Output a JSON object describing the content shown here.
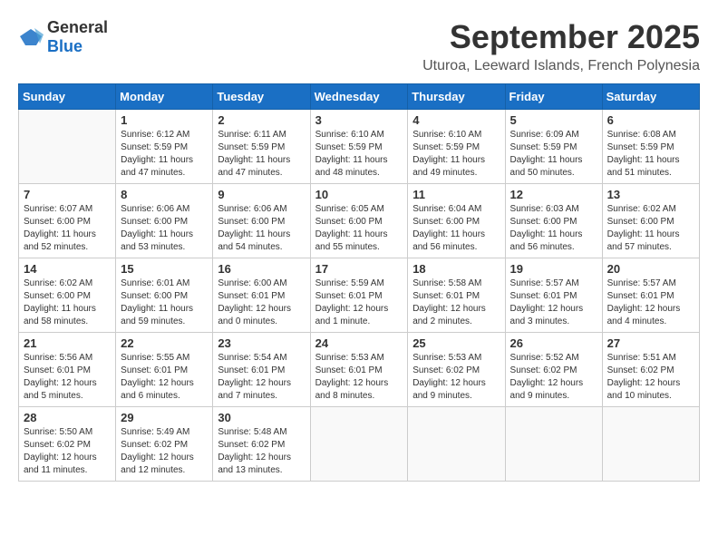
{
  "logo": {
    "general": "General",
    "blue": "Blue"
  },
  "title": "September 2025",
  "location": "Uturoa, Leeward Islands, French Polynesia",
  "weekdays": [
    "Sunday",
    "Monday",
    "Tuesday",
    "Wednesday",
    "Thursday",
    "Friday",
    "Saturday"
  ],
  "weeks": [
    [
      {
        "day": "",
        "info": ""
      },
      {
        "day": "1",
        "info": "Sunrise: 6:12 AM\nSunset: 5:59 PM\nDaylight: 11 hours\nand 47 minutes."
      },
      {
        "day": "2",
        "info": "Sunrise: 6:11 AM\nSunset: 5:59 PM\nDaylight: 11 hours\nand 47 minutes."
      },
      {
        "day": "3",
        "info": "Sunrise: 6:10 AM\nSunset: 5:59 PM\nDaylight: 11 hours\nand 48 minutes."
      },
      {
        "day": "4",
        "info": "Sunrise: 6:10 AM\nSunset: 5:59 PM\nDaylight: 11 hours\nand 49 minutes."
      },
      {
        "day": "5",
        "info": "Sunrise: 6:09 AM\nSunset: 5:59 PM\nDaylight: 11 hours\nand 50 minutes."
      },
      {
        "day": "6",
        "info": "Sunrise: 6:08 AM\nSunset: 5:59 PM\nDaylight: 11 hours\nand 51 minutes."
      }
    ],
    [
      {
        "day": "7",
        "info": "Sunrise: 6:07 AM\nSunset: 6:00 PM\nDaylight: 11 hours\nand 52 minutes."
      },
      {
        "day": "8",
        "info": "Sunrise: 6:06 AM\nSunset: 6:00 PM\nDaylight: 11 hours\nand 53 minutes."
      },
      {
        "day": "9",
        "info": "Sunrise: 6:06 AM\nSunset: 6:00 PM\nDaylight: 11 hours\nand 54 minutes."
      },
      {
        "day": "10",
        "info": "Sunrise: 6:05 AM\nSunset: 6:00 PM\nDaylight: 11 hours\nand 55 minutes."
      },
      {
        "day": "11",
        "info": "Sunrise: 6:04 AM\nSunset: 6:00 PM\nDaylight: 11 hours\nand 56 minutes."
      },
      {
        "day": "12",
        "info": "Sunrise: 6:03 AM\nSunset: 6:00 PM\nDaylight: 11 hours\nand 56 minutes."
      },
      {
        "day": "13",
        "info": "Sunrise: 6:02 AM\nSunset: 6:00 PM\nDaylight: 11 hours\nand 57 minutes."
      }
    ],
    [
      {
        "day": "14",
        "info": "Sunrise: 6:02 AM\nSunset: 6:00 PM\nDaylight: 11 hours\nand 58 minutes."
      },
      {
        "day": "15",
        "info": "Sunrise: 6:01 AM\nSunset: 6:00 PM\nDaylight: 11 hours\nand 59 minutes."
      },
      {
        "day": "16",
        "info": "Sunrise: 6:00 AM\nSunset: 6:01 PM\nDaylight: 12 hours\nand 0 minutes."
      },
      {
        "day": "17",
        "info": "Sunrise: 5:59 AM\nSunset: 6:01 PM\nDaylight: 12 hours\nand 1 minute."
      },
      {
        "day": "18",
        "info": "Sunrise: 5:58 AM\nSunset: 6:01 PM\nDaylight: 12 hours\nand 2 minutes."
      },
      {
        "day": "19",
        "info": "Sunrise: 5:57 AM\nSunset: 6:01 PM\nDaylight: 12 hours\nand 3 minutes."
      },
      {
        "day": "20",
        "info": "Sunrise: 5:57 AM\nSunset: 6:01 PM\nDaylight: 12 hours\nand 4 minutes."
      }
    ],
    [
      {
        "day": "21",
        "info": "Sunrise: 5:56 AM\nSunset: 6:01 PM\nDaylight: 12 hours\nand 5 minutes."
      },
      {
        "day": "22",
        "info": "Sunrise: 5:55 AM\nSunset: 6:01 PM\nDaylight: 12 hours\nand 6 minutes."
      },
      {
        "day": "23",
        "info": "Sunrise: 5:54 AM\nSunset: 6:01 PM\nDaylight: 12 hours\nand 7 minutes."
      },
      {
        "day": "24",
        "info": "Sunrise: 5:53 AM\nSunset: 6:01 PM\nDaylight: 12 hours\nand 8 minutes."
      },
      {
        "day": "25",
        "info": "Sunrise: 5:53 AM\nSunset: 6:02 PM\nDaylight: 12 hours\nand 9 minutes."
      },
      {
        "day": "26",
        "info": "Sunrise: 5:52 AM\nSunset: 6:02 PM\nDaylight: 12 hours\nand 9 minutes."
      },
      {
        "day": "27",
        "info": "Sunrise: 5:51 AM\nSunset: 6:02 PM\nDaylight: 12 hours\nand 10 minutes."
      }
    ],
    [
      {
        "day": "28",
        "info": "Sunrise: 5:50 AM\nSunset: 6:02 PM\nDaylight: 12 hours\nand 11 minutes."
      },
      {
        "day": "29",
        "info": "Sunrise: 5:49 AM\nSunset: 6:02 PM\nDaylight: 12 hours\nand 12 minutes."
      },
      {
        "day": "30",
        "info": "Sunrise: 5:48 AM\nSunset: 6:02 PM\nDaylight: 12 hours\nand 13 minutes."
      },
      {
        "day": "",
        "info": ""
      },
      {
        "day": "",
        "info": ""
      },
      {
        "day": "",
        "info": ""
      },
      {
        "day": "",
        "info": ""
      }
    ]
  ]
}
